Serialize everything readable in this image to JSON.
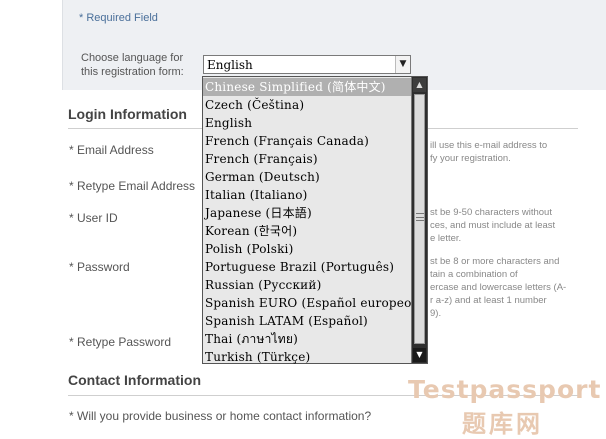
{
  "header": {
    "required_note": "* Required Field",
    "language_label_line1": "Choose language for",
    "language_label_line2": "this registration form:",
    "language_selected": "English",
    "dropdown_arrow": "▼"
  },
  "login_section": {
    "title": "Login Information",
    "email_label": "* Email Address",
    "email_hint_line1": "ill use this e-mail address to",
    "email_hint_line2": "fy your registration.",
    "retype_email_label": "* Retype Email Address",
    "user_id_label": "* User ID",
    "user_id_hint_line1": "st be 9-50 characters without",
    "user_id_hint_line2": "ces, and must include at least",
    "user_id_hint_line3": "e letter.",
    "password_label": "* Password",
    "password_hint_line1": "st be 8 or more characters and",
    "password_hint_line2": "tain a combination of",
    "password_hint_line3": "ercase and lowercase letters (A-",
    "password_hint_line4": "r a-z) and at least 1 number",
    "password_hint_line5": "9).",
    "retype_password_label": "* Retype Password"
  },
  "contact_section": {
    "title": "Contact Information",
    "question": "* Will you provide business or home contact information?"
  },
  "dropdown": {
    "options": [
      "Chinese Simplified (简体中文)",
      "Czech (Čeština)",
      "English",
      "French (Français Canada)",
      "French (Français)",
      "German (Deutsch)",
      "Italian (Italiano)",
      "Japanese (日本語)",
      "Korean (한국어)",
      "Polish (Polski)",
      "Portuguese Brazil (Português)",
      "Russian (Русский)",
      "Spanish EURO (Español europeo)",
      "Spanish LATAM (Español)",
      "Thai (ภาษาไทย)",
      "Turkish (Türkçe)"
    ],
    "highlighted_index": 0,
    "scroll_up_glyph": "▲",
    "scroll_down_glyph": "▼"
  },
  "watermark": {
    "line1": "Testpassport",
    "line2": "题库网"
  }
}
